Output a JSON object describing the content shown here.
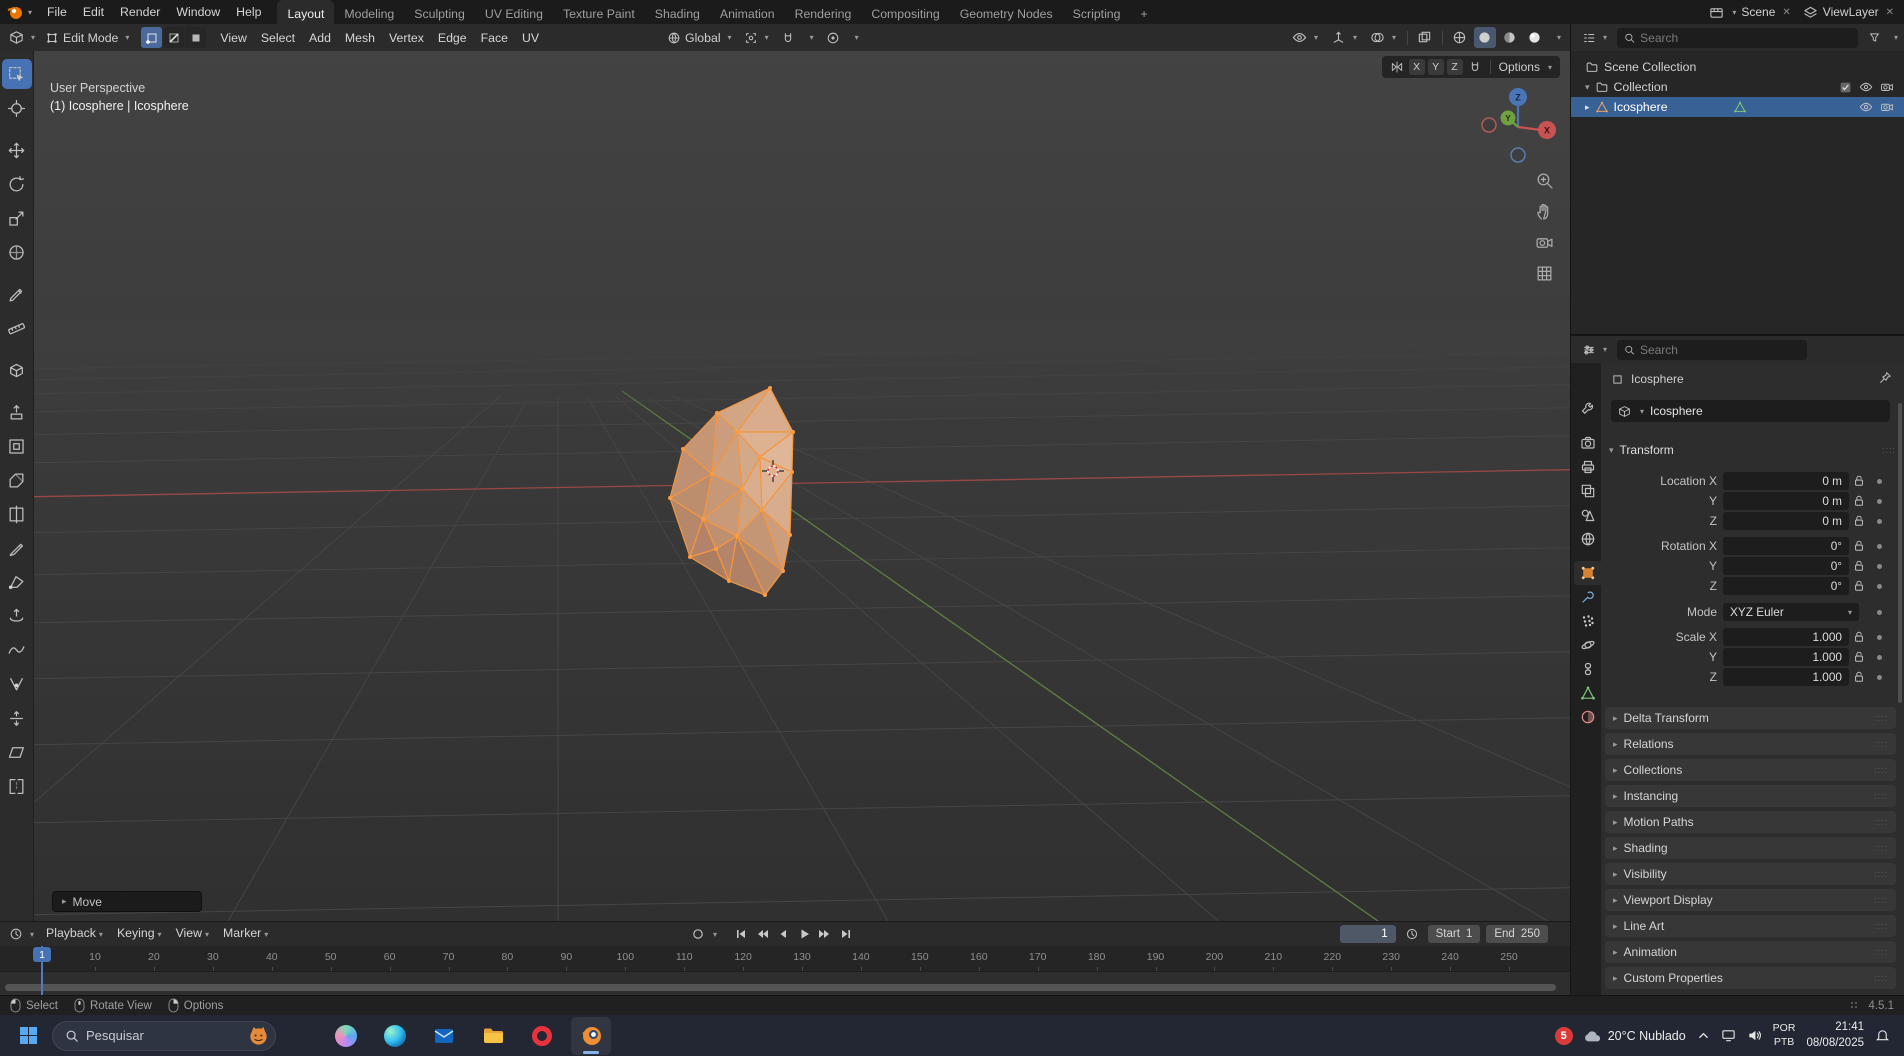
{
  "topbar": {
    "menus": [
      "File",
      "Edit",
      "Render",
      "Window",
      "Help"
    ],
    "workspaces": [
      "Layout",
      "Modeling",
      "Sculpting",
      "UV Editing",
      "Texture Paint",
      "Shading",
      "Animation",
      "Rendering",
      "Compositing",
      "Geometry Nodes",
      "Scripting"
    ],
    "active_workspace": "Layout",
    "add_tab_label": "+",
    "scene_label": "Scene",
    "view_layer_label": "ViewLayer"
  },
  "viewport_header": {
    "mode": "Edit Mode",
    "menus": [
      "View",
      "Select",
      "Add",
      "Mesh",
      "Vertex",
      "Edge",
      "Face",
      "UV"
    ],
    "orientation": "Global",
    "mirror_axes": [
      "X",
      "Y",
      "Z"
    ],
    "options_label": "Options"
  },
  "tools": [
    "Select Box",
    "Cursor",
    "Move",
    "Rotate",
    "Scale",
    "Transform",
    "Annotate",
    "Measure",
    "Add Cube",
    "Extrude Region",
    "Inset Faces",
    "Bevel",
    "Loop Cut",
    "Knife",
    "Poly Build",
    "Spin",
    "Smooth",
    "Edge Slide",
    "Shrink Fatten",
    "Shear",
    "Rip Region"
  ],
  "viewport": {
    "view_label": "User Perspective",
    "object_label": "(1) Icosphere | Icosphere",
    "operator_label": "Move",
    "gizmo_axes": {
      "x": "X",
      "y": "Y",
      "z": "Z"
    }
  },
  "timeline": {
    "menus": [
      "Playback",
      "Keying",
      "View",
      "Marker"
    ],
    "current_frame": "1",
    "playhead_label": "1",
    "start_label": "Start",
    "start_value": "1",
    "end_label": "End",
    "end_value": "250",
    "ticks": [
      10,
      20,
      30,
      40,
      50,
      60,
      70,
      80,
      90,
      100,
      110,
      120,
      130,
      140,
      150,
      160,
      170,
      180,
      190,
      200,
      210,
      220,
      230,
      240,
      250
    ]
  },
  "statusbar": {
    "hints": [
      "Select",
      "Rotate View",
      "Options"
    ],
    "version": "4.5.1"
  },
  "outliner": {
    "search_placeholder": "Search",
    "rows": [
      {
        "label": "Scene Collection"
      },
      {
        "label": "Collection"
      },
      {
        "label": "Icosphere"
      }
    ]
  },
  "properties": {
    "search_placeholder": "Search",
    "tabs": [
      "Tool",
      "Render",
      "Output",
      "View Layer",
      "Scene",
      "World",
      "Object",
      "Modifiers",
      "Particles",
      "Physics",
      "Constraints",
      "Object Data",
      "Material"
    ],
    "active_tab": "Object",
    "breadcrumb": "Icosphere",
    "object_name": "Icosphere",
    "transform_title": "Transform",
    "transform_rows": [
      {
        "label": "Location X",
        "value": "0 m"
      },
      {
        "label": "Y",
        "value": "0 m"
      },
      {
        "label": "Z",
        "value": "0 m"
      },
      {
        "label": "Rotation X",
        "value": "0°"
      },
      {
        "label": "Y",
        "value": "0°"
      },
      {
        "label": "Z",
        "value": "0°"
      },
      {
        "label": "Mode",
        "value": "XYZ Euler",
        "dropdown": true
      },
      {
        "label": "Scale X",
        "value": "1.000"
      },
      {
        "label": "Y",
        "value": "1.000"
      },
      {
        "label": "Z",
        "value": "1.000"
      }
    ],
    "panels": [
      "Delta Transform",
      "Relations",
      "Collections",
      "Instancing",
      "Motion Paths",
      "Shading",
      "Visibility",
      "Viewport Display",
      "Line Art",
      "Animation",
      "Custom Properties"
    ]
  },
  "taskbar": {
    "search_placeholder": "Pesquisar",
    "apps": [
      "Copilot",
      "Edge",
      "Outlook",
      "File Explorer",
      "Opera",
      "Blender"
    ],
    "active_app": "Blender",
    "notification_count": "5",
    "weather": "20°C Nublado",
    "lang_primary": "POR",
    "lang_secondary": "PTB",
    "time": "21:41",
    "date": "08/08/2025"
  }
}
